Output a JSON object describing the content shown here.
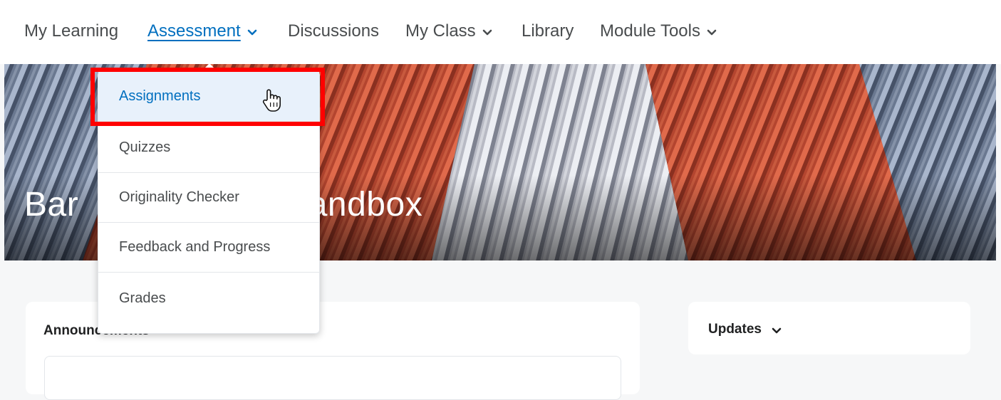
{
  "nav": {
    "items": [
      {
        "label": "My Learning",
        "has_dropdown": false
      },
      {
        "label": "Assessment",
        "has_dropdown": true,
        "active": true
      },
      {
        "label": "Discussions",
        "has_dropdown": false
      },
      {
        "label": "My Class",
        "has_dropdown": true
      },
      {
        "label": "Library",
        "has_dropdown": false
      },
      {
        "label": "Module Tools",
        "has_dropdown": true
      }
    ]
  },
  "banner": {
    "title_left": "Bar",
    "title_right": "Sandbox"
  },
  "assessment_menu": {
    "items": [
      {
        "label": "Assignments",
        "highlighted": true
      },
      {
        "label": "Quizzes"
      },
      {
        "label": "Originality Checker"
      },
      {
        "label": "Feedback and Progress"
      },
      {
        "label": "Grades"
      }
    ]
  },
  "widgets": {
    "announcements_title": "Announcements",
    "updates_title": "Updates"
  },
  "colors": {
    "link_blue": "#006fbf",
    "highlight_bg": "#e8f1fb",
    "annotation_red": "#ff0000",
    "page_bg": "#f6f7f8",
    "text": "#494c4e"
  },
  "icons": {
    "dropdown_chevron": "chevron-down-icon",
    "cursor": "hand-pointer-icon"
  }
}
